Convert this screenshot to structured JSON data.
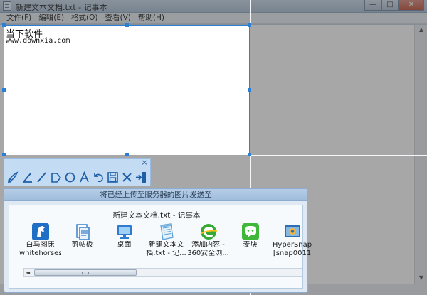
{
  "window": {
    "title": "新建文本文档.txt - 记事本",
    "minimize_glyph": "—",
    "maximize_glyph": "□",
    "close_glyph": "✕"
  },
  "menu": [
    {
      "label": "文件(F)"
    },
    {
      "label": "编辑(E)"
    },
    {
      "label": "格式(O)"
    },
    {
      "label": "查看(V)"
    },
    {
      "label": "帮助(H)"
    }
  ],
  "selection": {
    "line1": "当下软件",
    "line2": "www.downxia.com"
  },
  "toolbar": {
    "close_glyph": "×",
    "tools": [
      {
        "name": "brush-icon"
      },
      {
        "name": "line-icon"
      },
      {
        "name": "pencil-icon"
      },
      {
        "name": "arrow-callout-icon"
      },
      {
        "name": "ellipse-icon"
      },
      {
        "name": "text-icon"
      },
      {
        "name": "undo-icon"
      },
      {
        "name": "save-icon"
      },
      {
        "name": "cancel-icon"
      },
      {
        "name": "exit-icon"
      }
    ]
  },
  "dialog": {
    "header": "将已经上传至服务器的图片发送至",
    "subtitle": "新建文本文档.txt - 记事本",
    "targets": [
      {
        "line1": "白马图床",
        "line2": "whitehorses...",
        "icon": "horse-icon",
        "color": "#1f6fc4"
      },
      {
        "line1": "剪帖板",
        "line2": "",
        "icon": "clipboard-icon",
        "color": "#3a7fc9"
      },
      {
        "line1": "桌面",
        "line2": "",
        "icon": "monitor-icon",
        "color": "#2f7bd0"
      },
      {
        "line1": "新建文本文",
        "line2": "档.txt - 记...",
        "icon": "notepad-icon",
        "color": "#5aa0d8"
      },
      {
        "line1": "添加内容 -",
        "line2": "360安全浏...",
        "icon": "browser-360-icon",
        "color": "#35a835"
      },
      {
        "line1": "麦块",
        "line2": "",
        "icon": "chat-icon",
        "color": "#3fb83a"
      },
      {
        "line1": "HyperSnap",
        "line2": "[snap0011",
        "icon": "hypersnap-icon",
        "color": "#2d6db0"
      }
    ]
  }
}
